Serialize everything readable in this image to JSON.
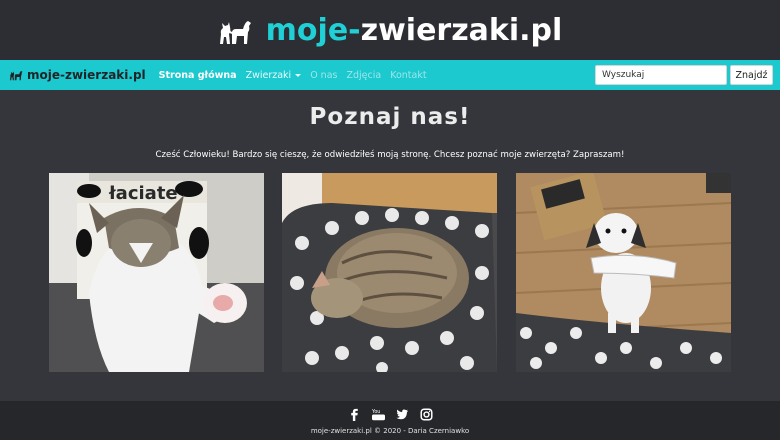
{
  "header": {
    "title_accent": "moje-",
    "title_rest": "zwierzaki.pl",
    "logo_icon": "cat-and-dog-icon"
  },
  "navbar": {
    "brand": "moje-zwierzaki.pl",
    "links": [
      {
        "label": "Strona główna",
        "state": "active"
      },
      {
        "label": "Zwierzaki",
        "state": "dropdown"
      },
      {
        "label": "O nas",
        "state": "dim"
      },
      {
        "label": "Zdjęcia",
        "state": "dim"
      },
      {
        "label": "Kontakt",
        "state": "dim"
      }
    ],
    "search_placeholder": "Wyszukaj",
    "search_button": "Znajdź"
  },
  "main": {
    "heading": "Poznaj nas!",
    "intro": "Cześć Człowieku! Bardzo się cieszę, że odwiedziłeś moją stronę. Chcesz poznać moje zwierzęta? Zapraszam!",
    "photos": [
      {
        "subject": "cat-reaching-paw",
        "box_text": "łaciate"
      },
      {
        "subject": "cat-sleeping-on-pillow"
      },
      {
        "subject": "dog-holding-shoe"
      }
    ]
  },
  "footer": {
    "social": [
      "facebook-icon",
      "youtube-icon",
      "twitter-icon",
      "instagram-icon"
    ],
    "text": "moje-zwierzaki.pl © 2020 - Daria Czerniawko"
  },
  "colors": {
    "accent": "#1bc9cf",
    "background": "#34363b",
    "header": "#2c2e33",
    "footer": "#25272b"
  }
}
